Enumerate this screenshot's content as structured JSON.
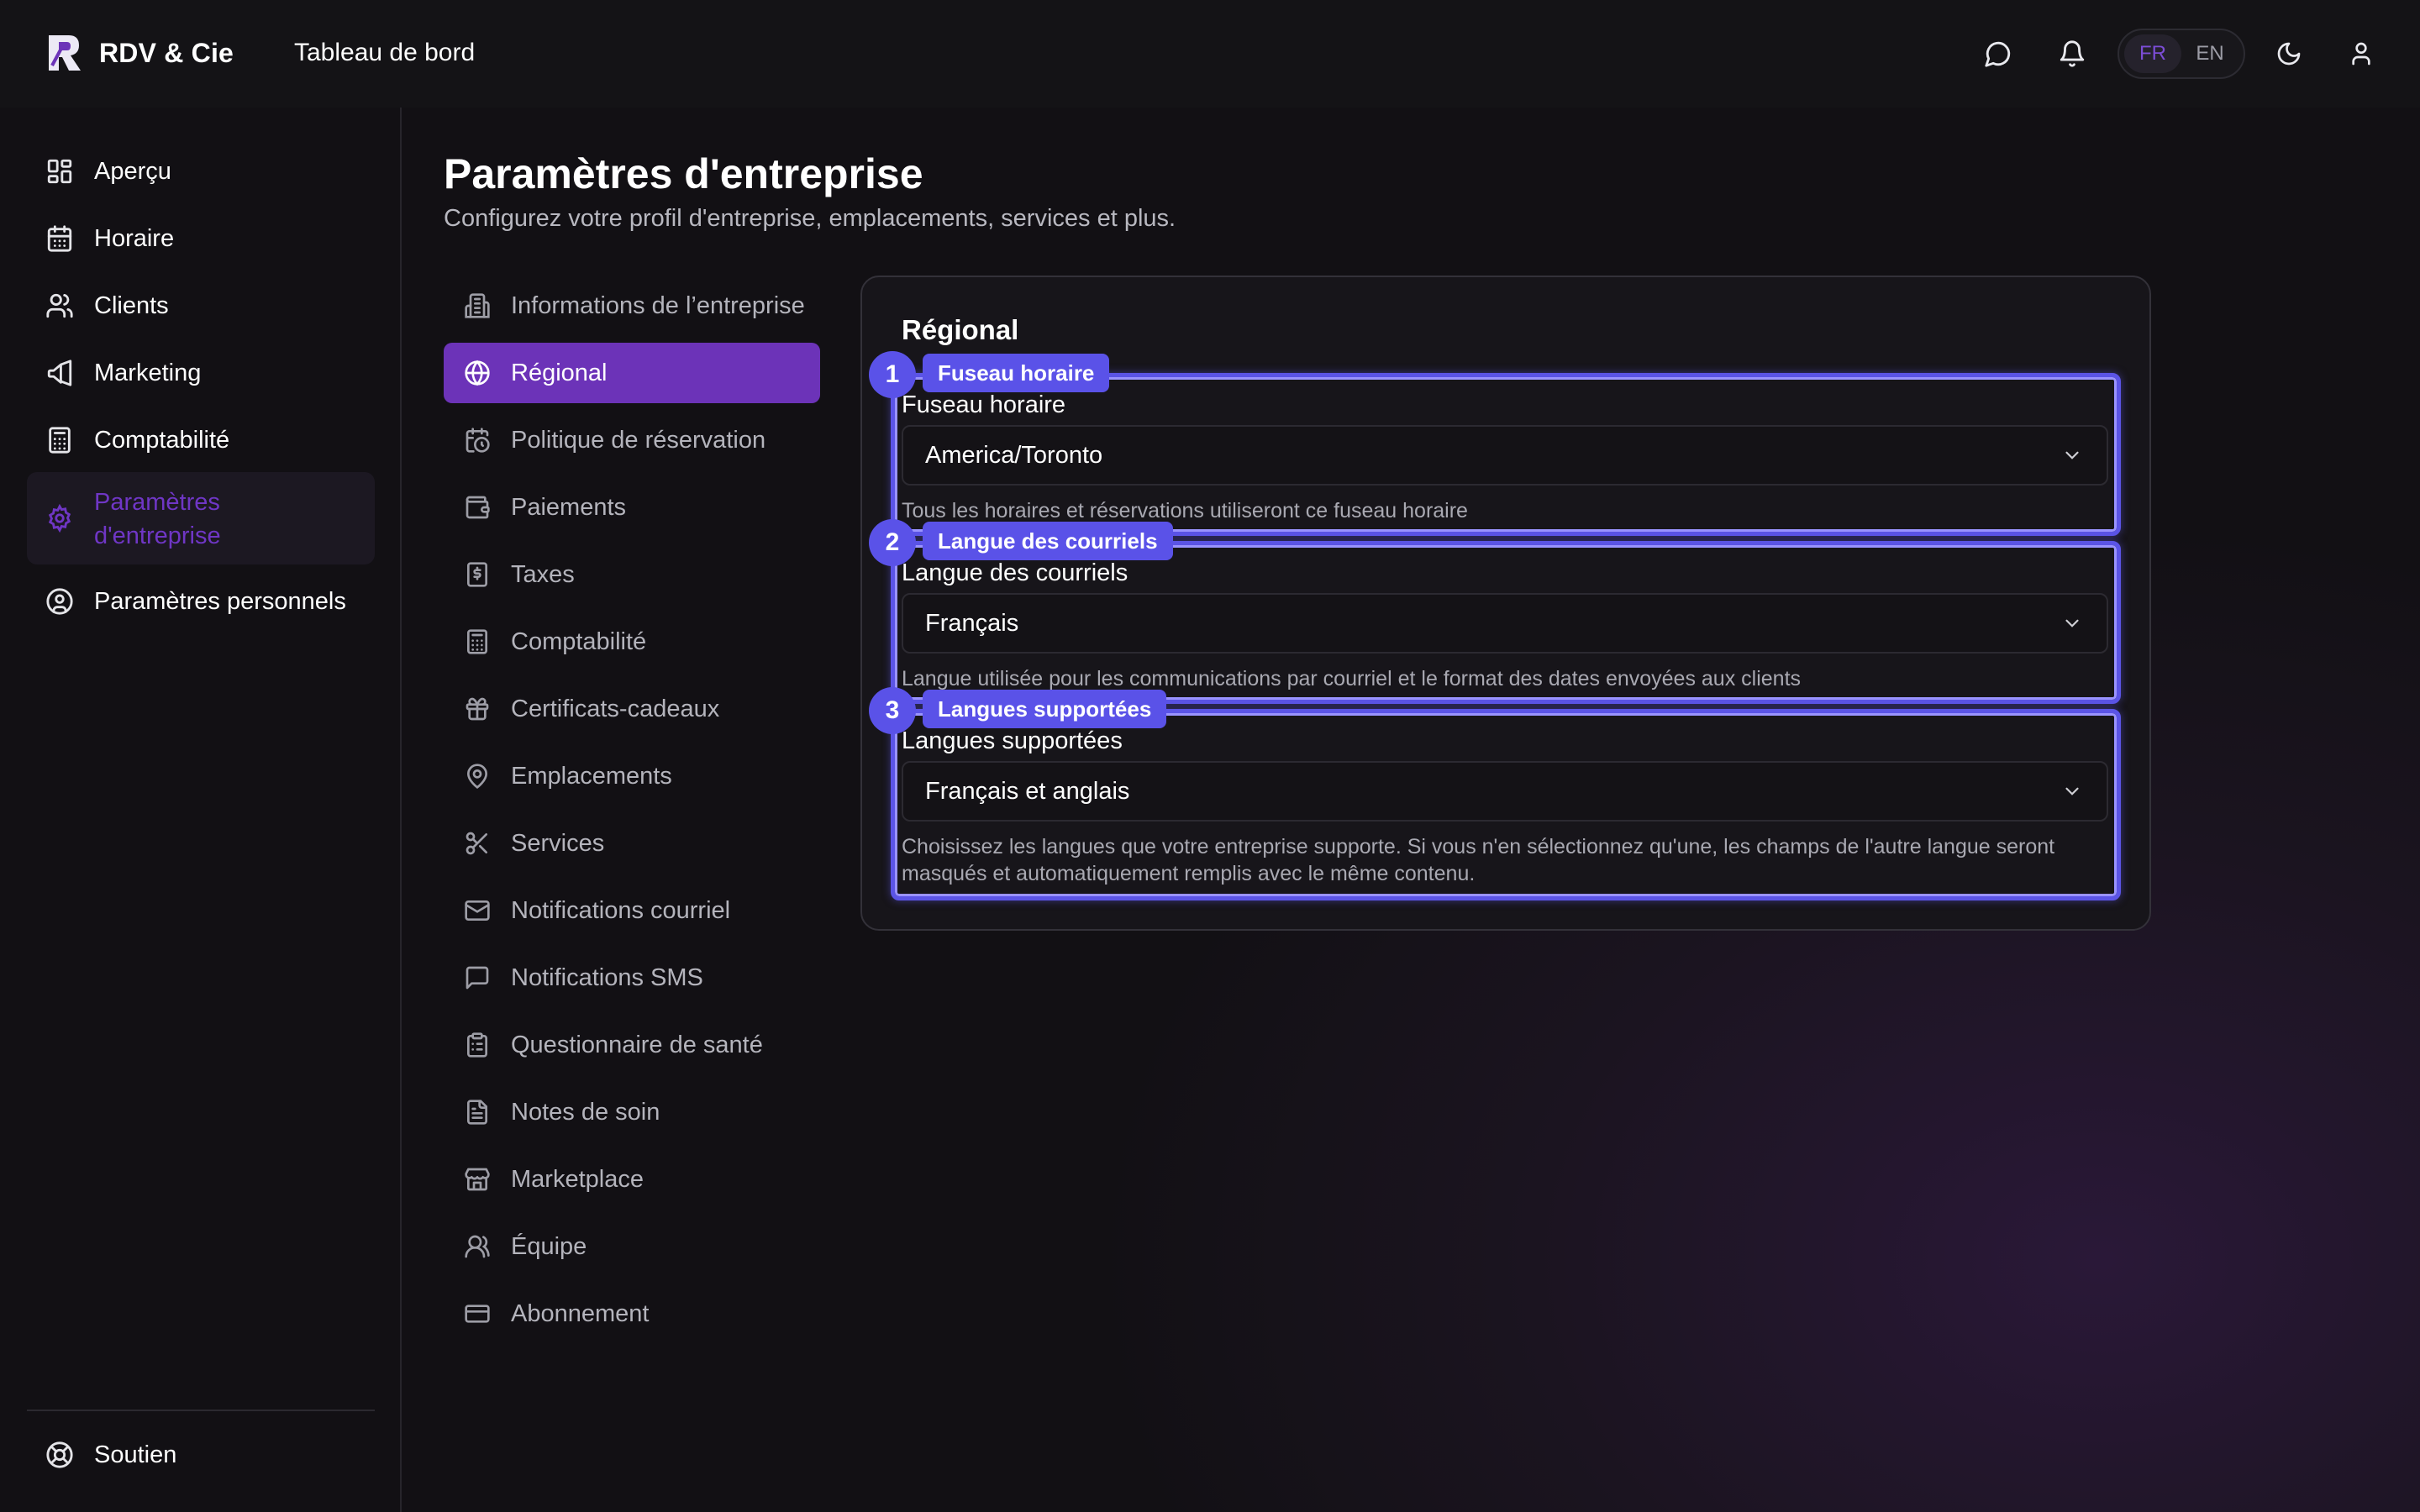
{
  "brand": {
    "name": "RDV & Cie"
  },
  "topbar": {
    "title": "Tableau de bord",
    "lang_fr": "FR",
    "lang_en": "EN"
  },
  "sidebar": {
    "items": [
      {
        "label": "Aperçu",
        "icon": "dashboard-icon"
      },
      {
        "label": "Horaire",
        "icon": "calendar-icon"
      },
      {
        "label": "Clients",
        "icon": "users-icon"
      },
      {
        "label": "Marketing",
        "icon": "megaphone-icon"
      },
      {
        "label": "Comptabilité",
        "icon": "calculator-icon"
      },
      {
        "label": "Paramètres d'entreprise",
        "icon": "gear-icon",
        "active": true
      },
      {
        "label": "Paramètres personnels",
        "icon": "user-circle-icon"
      }
    ],
    "support": "Soutien"
  },
  "page": {
    "title": "Paramètres d'entreprise",
    "subtitle": "Configurez votre profil d'entreprise, emplacements, services et plus."
  },
  "subnav": {
    "items": [
      {
        "label": "Informations de l’entreprise",
        "icon": "building-icon"
      },
      {
        "label": "Régional",
        "icon": "globe-icon",
        "active": true
      },
      {
        "label": "Politique de réservation",
        "icon": "calendar-clock-icon"
      },
      {
        "label": "Paiements",
        "icon": "wallet-icon"
      },
      {
        "label": "Taxes",
        "icon": "receipt-dollar-icon"
      },
      {
        "label": "Comptabilité",
        "icon": "calculator-icon"
      },
      {
        "label": "Certificats-cadeaux",
        "icon": "gift-icon"
      },
      {
        "label": "Emplacements",
        "icon": "map-pin-icon"
      },
      {
        "label": "Services",
        "icon": "scissors-icon"
      },
      {
        "label": "Notifications courriel",
        "icon": "mail-icon"
      },
      {
        "label": "Notifications SMS",
        "icon": "message-square-icon"
      },
      {
        "label": "Questionnaire de santé",
        "icon": "clipboard-icon"
      },
      {
        "label": "Notes de soin",
        "icon": "file-text-icon"
      },
      {
        "label": "Marketplace",
        "icon": "store-icon"
      },
      {
        "label": "Équipe",
        "icon": "team-icon"
      },
      {
        "label": "Abonnement",
        "icon": "credit-card-icon"
      }
    ]
  },
  "regional": {
    "title": "Régional",
    "fields": [
      {
        "badge": "1",
        "tag": "Fuseau horaire",
        "label": "Fuseau horaire",
        "value": "America/Toronto",
        "help": "Tous les horaires et réservations utiliseront ce fuseau horaire"
      },
      {
        "badge": "2",
        "tag": "Langue des courriels",
        "label": "Langue des courriels",
        "value": "Français",
        "help": "Langue utilisée pour les communications par courriel et le format des dates envoyées aux clients"
      },
      {
        "badge": "3",
        "tag": "Langues supportées",
        "label": "Langues supportées",
        "value": "Français et anglais",
        "help": "Choisissez les langues que votre entreprise supporte. Si vous n'en sélectionnez qu'une, les champs de l'autre langue seront masqués et automatiquement remplis avec le même contenu."
      }
    ]
  },
  "colors": {
    "accent_purple": "#6c33b8",
    "highlight_indigo": "#5a52e8"
  }
}
